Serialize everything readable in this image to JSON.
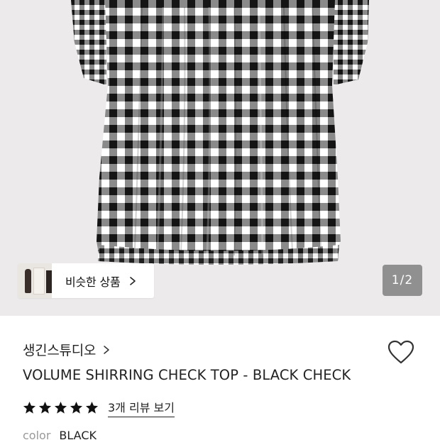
{
  "hero": {
    "image": "black-white-gingham-shirring-top",
    "colors": {
      "background": "#eceaea",
      "check_dark": "#1a1a1a",
      "check_light": "#ffffff"
    }
  },
  "similar_products": {
    "label": "비슷한 상품",
    "icon": "chevron-right-icon"
  },
  "gallery": {
    "current": "1",
    "separator": "/",
    "total": "2"
  },
  "brand": {
    "name": "생긴스튜디오",
    "icon": "chevron-right-icon"
  },
  "wishlist": {
    "icon": "heart-outline-icon"
  },
  "product": {
    "title": "VOLUME SHIRRING CHECK TOP - BLACK CHECK"
  },
  "rating": {
    "stars": 5,
    "star_icon": "star-filled-icon",
    "review_link": "3개 리뷰 보기"
  },
  "option": {
    "label": "color",
    "value": "BLACK"
  }
}
